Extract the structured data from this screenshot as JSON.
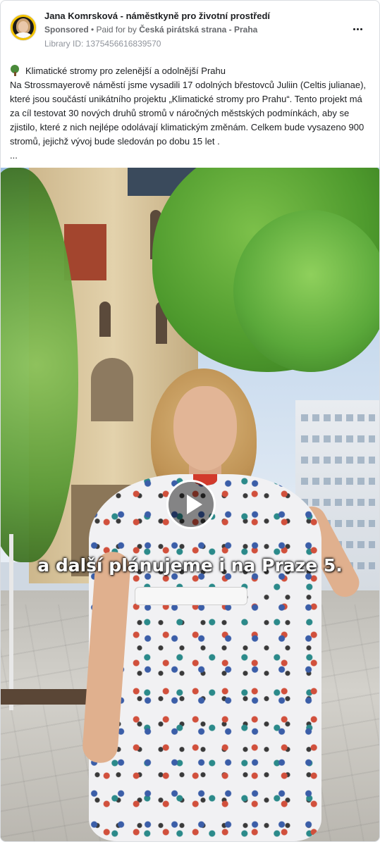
{
  "header": {
    "page_name": "Jana Komrsková - náměstkyně pro životní prostředí",
    "sponsored_label": "Sponsored",
    "separator": " • ",
    "paid_for_by_prefix": "Paid for by ",
    "paid_for_by_name": "Česká pirátská strana - Praha",
    "library_id": "Library ID: 1375456616839570"
  },
  "body": {
    "icon": "deciduous-tree-emoji",
    "headline": "Klimatické stromy pro zelenější a odolnější Prahu",
    "paragraph": "Na Strossmayerově náměstí jsme vysadili 17 odolných břestovců Juliin (Celtis julianae), které jsou součástí unikátního projektu „Klimatické stromy pro Prahu“. Tento projekt má za cíl testovat 30 nových druhů stromů v náročných městských podmínkách, aby se zjistilo, které z nich nejlépe odolávají klimatickým změnám. Celkem bude vysazeno 900 stromů, jejichž vývoj bude sledován po dobu 15 let .",
    "ellipsis": "..."
  },
  "video": {
    "caption": "a další plánujeme i na Praze 5.",
    "play_icon": "play-icon"
  },
  "icons": {
    "more": "more-options-icon"
  }
}
